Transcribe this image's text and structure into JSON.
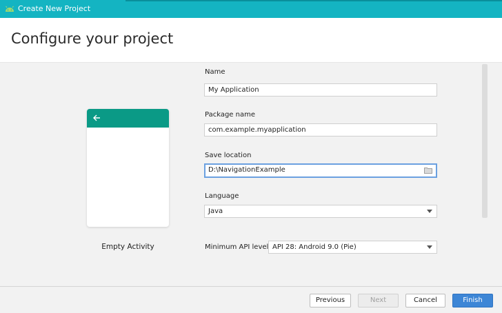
{
  "window": {
    "title": "Create New Project"
  },
  "header": {
    "title": "Configure your project"
  },
  "template": {
    "name": "Empty Activity"
  },
  "form": {
    "name": {
      "label": "Name",
      "value": "My Application"
    },
    "package": {
      "label": "Package name",
      "value": "com.example.myapplication"
    },
    "save_location": {
      "label": "Save location",
      "value": "D:\\NavigationExample"
    },
    "language": {
      "label": "Language",
      "value": "Java"
    },
    "min_api": {
      "label": "Minimum API level",
      "value": "API 28: Android 9.0 (Pie)"
    }
  },
  "buttons": {
    "previous": "Previous",
    "next": "Next",
    "cancel": "Cancel",
    "finish": "Finish"
  },
  "colors": {
    "titlebar": "#14b4c2",
    "card_bar": "#0a9a86",
    "primary_button": "#3d86d6"
  }
}
